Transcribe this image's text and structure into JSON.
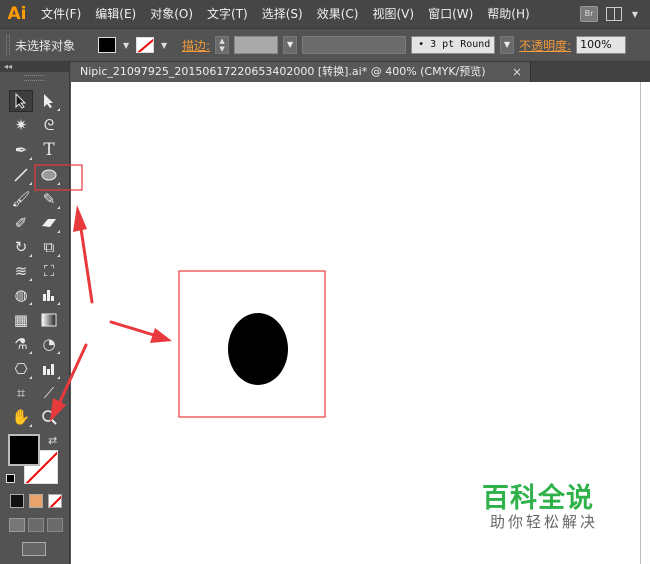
{
  "app": {
    "logo": "Ai",
    "bridge_label": "Br"
  },
  "menu": {
    "items": [
      "文件(F)",
      "编辑(E)",
      "对象(O)",
      "文字(T)",
      "选择(S)",
      "效果(C)",
      "视图(V)",
      "窗口(W)",
      "帮助(H)"
    ]
  },
  "control_bar": {
    "selection_label": "未选择对象",
    "stroke_label": "描边:",
    "stroke_style": "• 3 pt Round",
    "opacity_label": "不透明度:",
    "opacity_value": "100%"
  },
  "document": {
    "tab_title": "Nipic_21097925_20150617220653402000 [转换].ai* @ 400% (CMYK/预览)",
    "close_glyph": "×"
  },
  "tools": {
    "type_tool_glyph": "T"
  },
  "watermark": {
    "title": "百科全说",
    "subtitle": "助你轻松解决"
  },
  "colors": {
    "annotation_red": "#e8393c",
    "watermark_green": "#2fb24a",
    "logo_orange": "#ff9a00"
  }
}
